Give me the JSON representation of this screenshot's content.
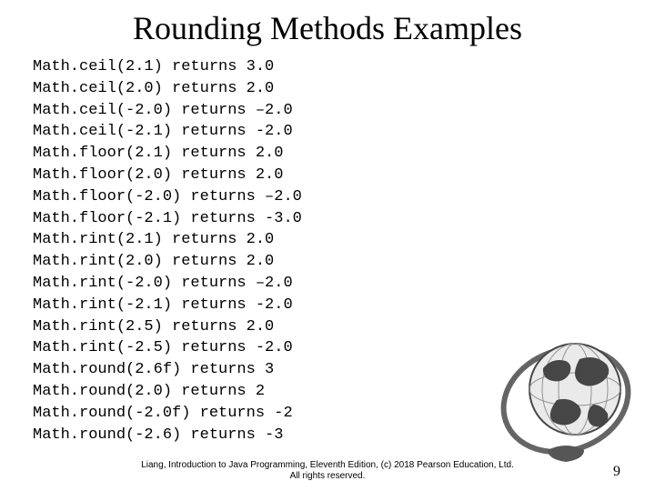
{
  "title": "Rounding Methods Examples",
  "lines": [
    "Math.ceil(2.1) returns 3.0",
    "Math.ceil(2.0) returns 2.0",
    "Math.ceil(-2.0) returns –2.0",
    "Math.ceil(-2.1) returns -2.0",
    "Math.floor(2.1) returns 2.0",
    "Math.floor(2.0) returns 2.0",
    "Math.floor(-2.0) returns –2.0",
    "Math.floor(-2.1) returns -3.0",
    "Math.rint(2.1) returns 2.0",
    "Math.rint(2.0) returns 2.0",
    "Math.rint(-2.0) returns –2.0",
    "Math.rint(-2.1) returns -2.0",
    "Math.rint(2.5) returns 2.0",
    "Math.rint(-2.5) returns -2.0",
    "Math.round(2.6f) returns 3",
    "Math.round(2.0) returns 2",
    "Math.round(-2.0f) returns -2",
    "Math.round(-2.6) returns -3"
  ],
  "footer": {
    "line1": "Liang, Introduction to Java Programming, Eleventh Edition, (c) 2018 Pearson Education, Ltd.",
    "line2": "All rights reserved."
  },
  "page_number": "9"
}
